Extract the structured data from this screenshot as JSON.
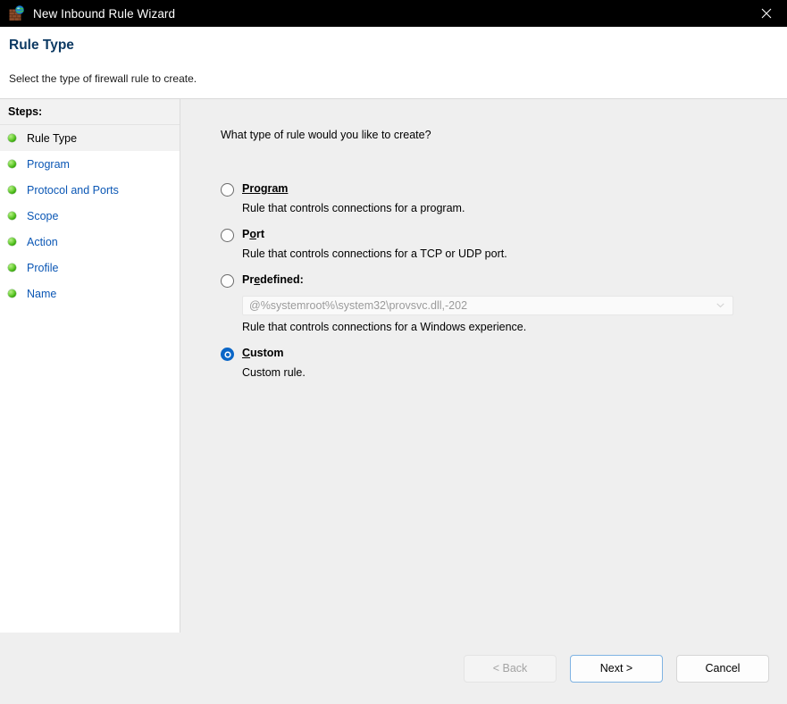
{
  "window": {
    "title": "New Inbound Rule Wizard",
    "icon": "firewall-brick-globe-icon",
    "close_label": "✕"
  },
  "header": {
    "title": "Rule Type",
    "subtitle": "Select the type of firewall rule to create.",
    "title_color": "#0d3a63"
  },
  "sidebar": {
    "heading": "Steps:",
    "items": [
      {
        "label": "Rule Type",
        "current": true
      },
      {
        "label": "Program",
        "current": false
      },
      {
        "label": "Protocol and Ports",
        "current": false
      },
      {
        "label": "Scope",
        "current": false
      },
      {
        "label": "Action",
        "current": false
      },
      {
        "label": "Profile",
        "current": false
      },
      {
        "label": "Name",
        "current": false
      }
    ],
    "link_color": "#0b57b5",
    "bullet_color": "#35a707"
  },
  "main": {
    "question": "What type of rule would you like to create?",
    "options": [
      {
        "label_pre": "",
        "label_acc": "Program",
        "label_post": "",
        "description": "Rule that controls connections for a program.",
        "selected": false
      },
      {
        "label_pre": "P",
        "label_acc": "o",
        "label_post": "rt",
        "description": "Rule that controls connections for a TCP or UDP port.",
        "selected": false
      },
      {
        "label_pre": "Pr",
        "label_acc": "e",
        "label_post": "defined:",
        "description": "Rule that controls connections for a Windows experience.",
        "selected": false,
        "combo": {
          "value": "@%systemroot%\\system32\\provsvc.dll,-202",
          "disabled": true,
          "arrow_icon": "chevron-down-icon"
        }
      },
      {
        "label_pre": "",
        "label_acc": "C",
        "label_post": "ustom",
        "description": "Custom rule.",
        "selected": true
      }
    ],
    "accent_color": "#0a66c7"
  },
  "footer": {
    "back_label": "< Back",
    "back_disabled": true,
    "next_label": "Next >",
    "next_default": true,
    "cancel_label": "Cancel"
  }
}
